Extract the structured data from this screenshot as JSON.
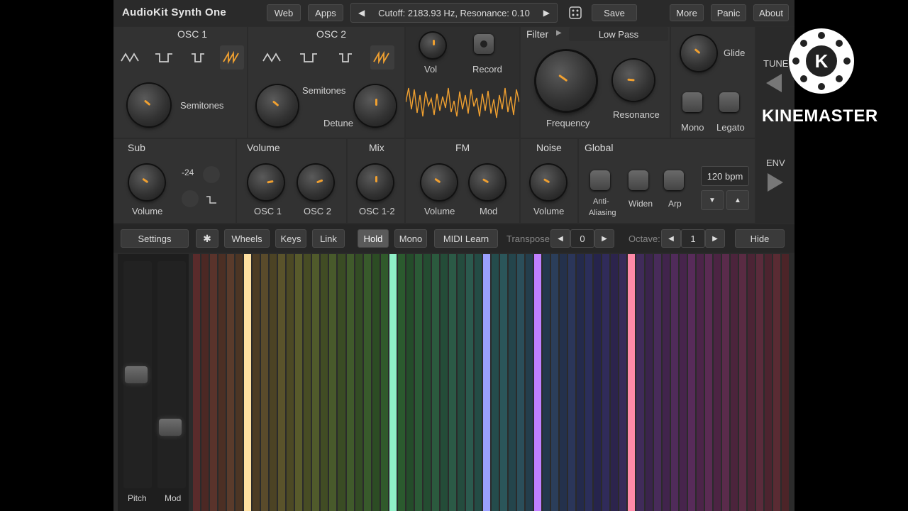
{
  "app": {
    "title": "AudioKit Synth One",
    "web": "Web",
    "apps": "Apps",
    "status": "Cutoff: 2183.93 Hz, Resonance: 0.10",
    "save": "Save",
    "more": "More",
    "panic": "Panic",
    "about": "About"
  },
  "osc1": {
    "title": "OSC 1",
    "semitones": "Semitones"
  },
  "osc2": {
    "title": "OSC 2",
    "semitones": "Semitones",
    "detune": "Detune"
  },
  "scope": {
    "vol": "Vol",
    "record": "Record"
  },
  "filter": {
    "title": "Filter",
    "type": "Low Pass",
    "frequency": "Frequency",
    "resonance": "Resonance"
  },
  "glide": {
    "label": "Glide",
    "mono": "Mono",
    "legato": "Legato"
  },
  "sub": {
    "title": "Sub",
    "octave": "-24",
    "volume": "Volume"
  },
  "volume": {
    "title": "Volume",
    "osc1": "OSC 1",
    "osc2": "OSC 2"
  },
  "mix": {
    "title": "Mix",
    "osc12": "OSC 1-2"
  },
  "fm": {
    "title": "FM",
    "volume": "Volume",
    "mod": "Mod"
  },
  "noise": {
    "title": "Noise",
    "volume": "Volume"
  },
  "global": {
    "title": "Global",
    "anti": "Anti-",
    "aliasing": "Aliasing",
    "widen": "Widen",
    "arp": "Arp",
    "bpm": "120 bpm"
  },
  "side": {
    "tune": "TUNE",
    "env": "ENV"
  },
  "toolbar": {
    "settings": "Settings",
    "wheels": "Wheels",
    "keys": "Keys",
    "link": "Link",
    "hold": "Hold",
    "mono": "Mono",
    "midi_learn": "MIDI Learn",
    "transpose": "Transpose:",
    "transpose_value": "0",
    "octave": "Octave:",
    "octave_value": "1",
    "hide": "Hide"
  },
  "wheels": {
    "pitch": "Pitch",
    "mod": "Mod",
    "pitch_level": 0.5,
    "mod_level": 0.25
  },
  "watermark": {
    "brand": "KINEMASTER"
  },
  "colors": {
    "accent": "#f0a030",
    "panel": "#323232",
    "background": "#2b2b2b"
  },
  "keys": {
    "count": 70,
    "highlighted": [
      {
        "index": 6,
        "color": "#ffe0a0"
      },
      {
        "index": 23,
        "color": "#90f0c8"
      },
      {
        "index": 34,
        "color": "#9aa0ff"
      },
      {
        "index": 40,
        "color": "#c080ff"
      },
      {
        "index": 51,
        "color": "#ff8aa8"
      }
    ]
  }
}
